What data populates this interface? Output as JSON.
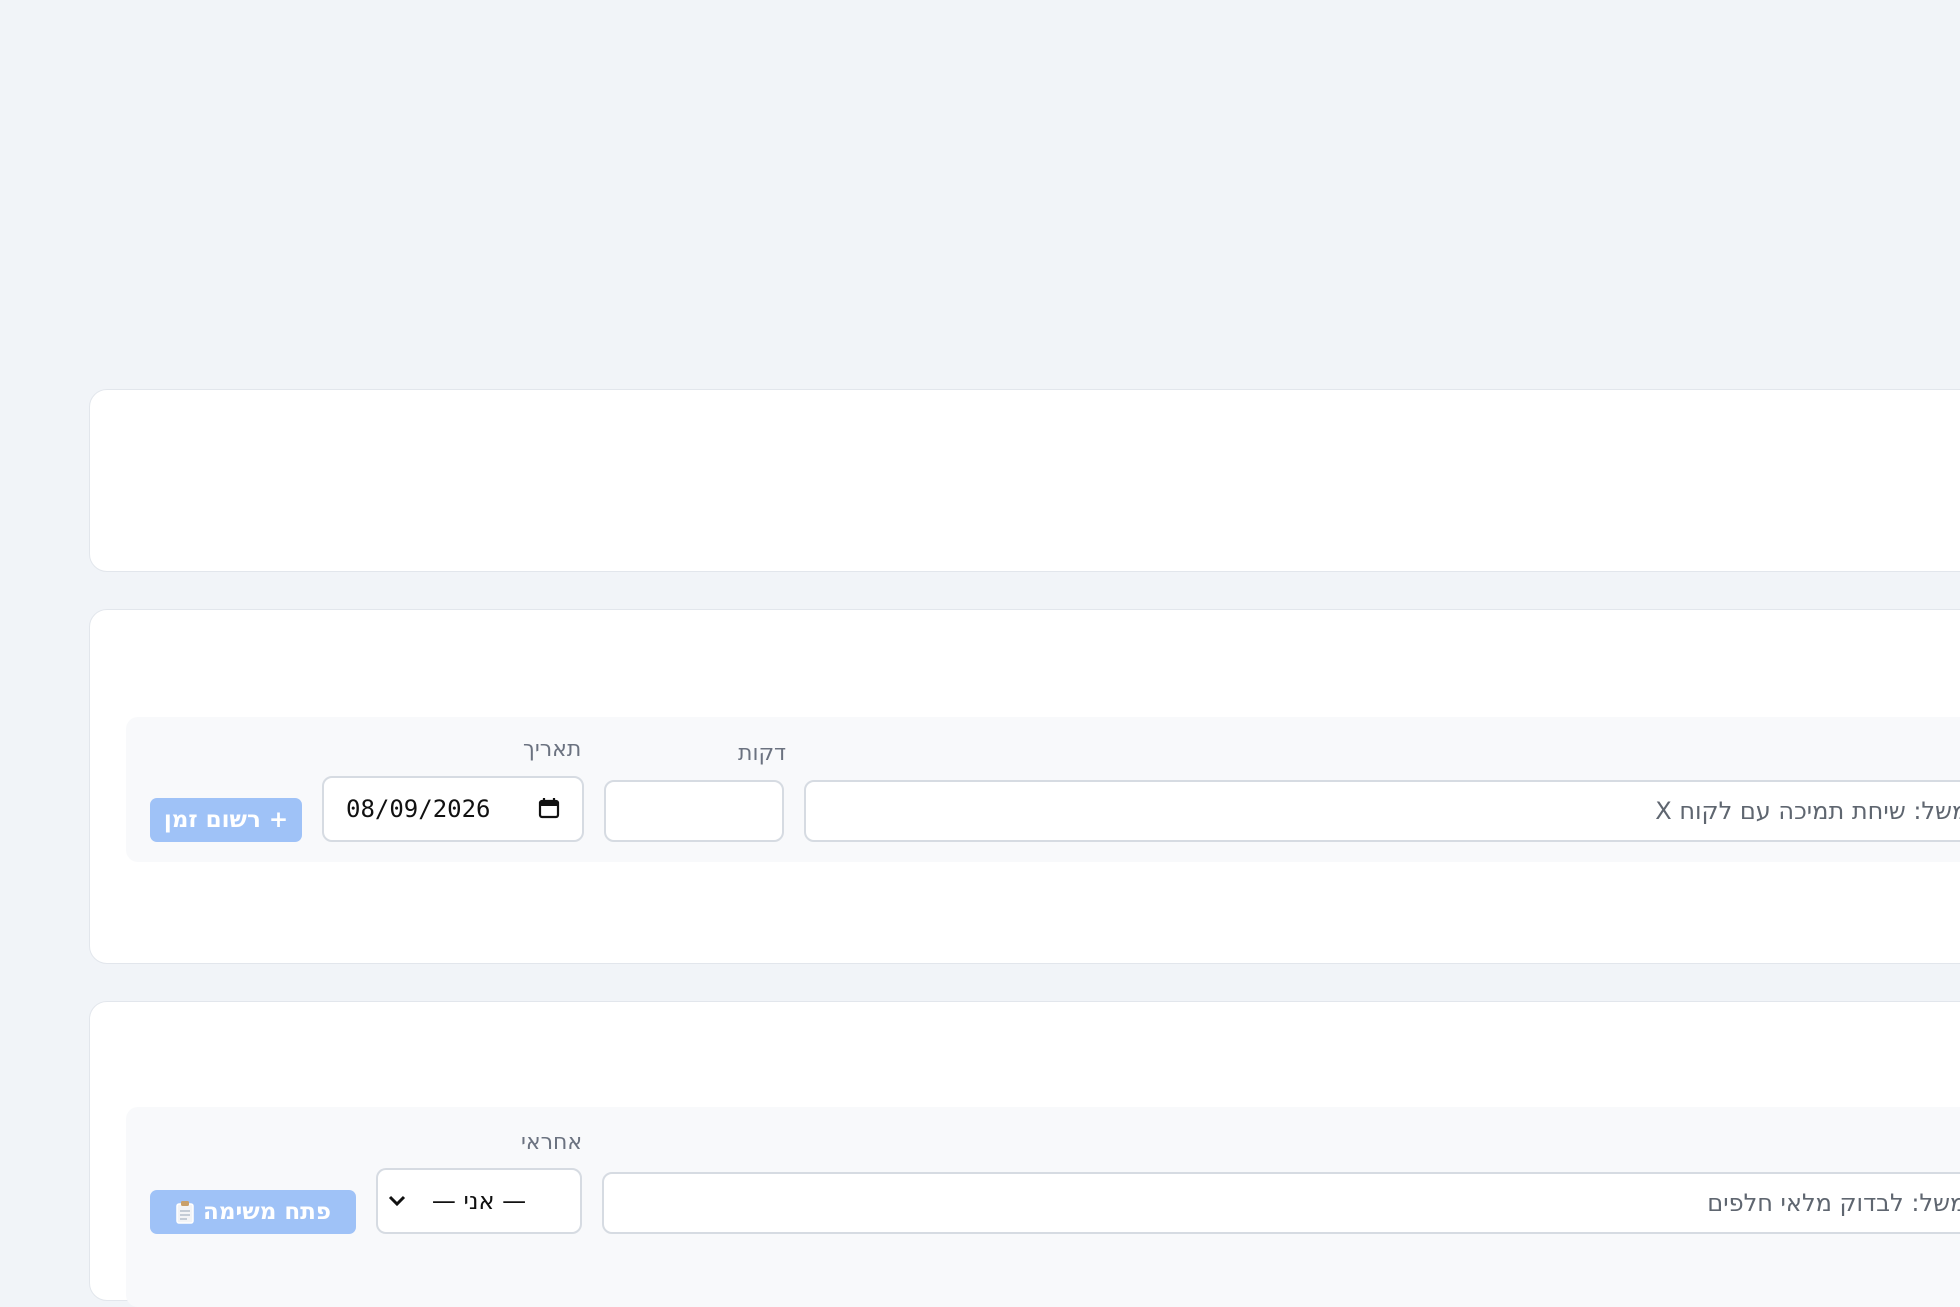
{
  "time_form": {
    "submit_label": "+ רשום זמן",
    "date_label": "תאריך",
    "date_value": "08/09/2026",
    "minutes_label": "דקות",
    "minutes_value": "",
    "description_placeholder": "למשל: שיחת תמיכה עם לקוח X"
  },
  "task_form": {
    "submit_label": "פתח משימה",
    "submit_icon": "clipboard-icon",
    "assignee_label": "אחראי",
    "assignee_selected": "— אני —",
    "description_placeholder": "למשל: לבדוק מלאי חלפים"
  },
  "colors": {
    "background": "#f1f4f8",
    "card": "#ffffff",
    "button": "#9fc2f7"
  }
}
